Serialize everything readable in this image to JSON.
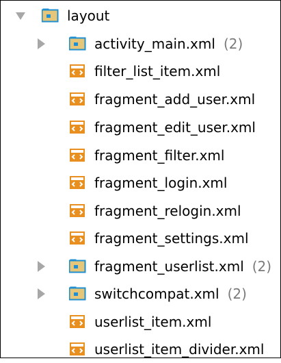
{
  "tree": {
    "folder": {
      "label": "layout",
      "expanded": true,
      "icon": "folder-icon"
    },
    "items": [
      {
        "label": "activity_main.xml",
        "count": "(2)",
        "icon": "folder-icon",
        "expandable": true
      },
      {
        "label": "filter_list_item.xml",
        "count": "",
        "icon": "xml-file-icon",
        "expandable": false
      },
      {
        "label": "fragment_add_user.xml",
        "count": "",
        "icon": "xml-file-icon",
        "expandable": false
      },
      {
        "label": "fragment_edit_user.xml",
        "count": "",
        "icon": "xml-file-icon",
        "expandable": false
      },
      {
        "label": "fragment_filter.xml",
        "count": "",
        "icon": "xml-file-icon",
        "expandable": false
      },
      {
        "label": "fragment_login.xml",
        "count": "",
        "icon": "xml-file-icon",
        "expandable": false
      },
      {
        "label": "fragment_relogin.xml",
        "count": "",
        "icon": "xml-file-icon",
        "expandable": false
      },
      {
        "label": "fragment_settings.xml",
        "count": "",
        "icon": "xml-file-icon",
        "expandable": false
      },
      {
        "label": "fragment_userlist.xml",
        "count": "(2)",
        "icon": "folder-icon",
        "expandable": true
      },
      {
        "label": "switchcompat.xml",
        "count": "(2)",
        "icon": "folder-icon",
        "expandable": true
      },
      {
        "label": "userlist_item.xml",
        "count": "",
        "icon": "xml-file-icon",
        "expandable": false
      },
      {
        "label": "userlist_item_divider.xml",
        "count": "",
        "icon": "xml-file-icon",
        "expandable": false
      }
    ]
  },
  "colors": {
    "folder_blue": "#1f8fd2",
    "folder_tan": "#e6c77a",
    "xml_orange": "#e88f1f",
    "arrow_gray": "#a7a7a7",
    "count_gray": "#7a7a7a"
  }
}
